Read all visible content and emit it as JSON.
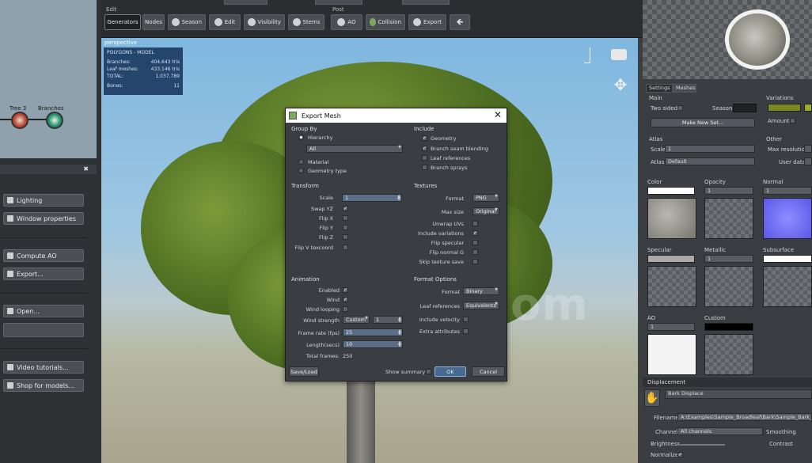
{
  "toolbar": {
    "edit_label": "Edit",
    "post_label": "Post",
    "buttons": [
      {
        "label": "Generators",
        "icon": "generators-icon"
      },
      {
        "label": "Nodes",
        "icon": "nodes-icon"
      },
      {
        "label": "Season",
        "icon": "season-icon"
      },
      {
        "label": "Edit",
        "icon": "edit-icon"
      },
      {
        "label": "Visibility",
        "icon": "visibility-icon"
      },
      {
        "label": "Stems",
        "icon": "stems-icon"
      },
      {
        "label": "AO",
        "icon": "ao-icon"
      },
      {
        "label": "Collision",
        "icon": "collision-icon"
      },
      {
        "label": "Export",
        "icon": "export-icon"
      }
    ]
  },
  "left_panel": {
    "nodes": [
      {
        "label": "Tree 3"
      },
      {
        "label": "Branches"
      }
    ],
    "buttons": {
      "lighting": "Lighting",
      "window_properties": "Window properties",
      "compute_ao": "Compute AO",
      "export": "Export...",
      "open": "Open...",
      "video_tutorials": "Video tutorials...",
      "shop_models": "Shop for models..."
    }
  },
  "viewport": {
    "view_name": "perspective",
    "stats_title": "POLYGONS - MODEL",
    "stats": [
      {
        "label": "Branches:",
        "value": "404,643 tris"
      },
      {
        "label": "Leaf meshes:",
        "value": "433,146 tris"
      },
      {
        "label": "TOTAL:",
        "value": "1,037,789"
      },
      {
        "label": "Bones:",
        "value": "11"
      }
    ],
    "watermark": "iiivfx.com"
  },
  "dialog": {
    "title": "Export Mesh",
    "group_by": {
      "title": "Group By",
      "hierarchy": "Hierarchy",
      "hierarchy_value": "All",
      "material": "Material",
      "geometry_type": "Geometry type"
    },
    "include": {
      "title": "Include",
      "geometry": "Geometry",
      "branch_seam_blending": "Branch seam blending",
      "leaf_references": "Leaf references",
      "branch_sprays": "Branch sprays"
    },
    "transform": {
      "title": "Transform",
      "scale_label": "Scale",
      "scale_value": "1",
      "swap_yz": "Swap YZ",
      "flip_x": "Flip X",
      "flip_y": "Flip Y",
      "flip_z": "Flip Z",
      "flip_v_texcoord": "Flip V texcoord"
    },
    "textures": {
      "title": "Textures",
      "format_label": "Format",
      "format_value": "PNG",
      "max_size_label": "Max size",
      "max_size_value": "Original",
      "unwrap_uvs": "Unwrap UVs",
      "include_variations": "Include variations",
      "flip_specular": "Flip specular",
      "flip_normal_g": "Flip normal G",
      "skip_texture_save": "Skip texture save"
    },
    "animation": {
      "title": "Animation",
      "enabled": "Enabled",
      "wind": "Wind",
      "wind_looping": "Wind looping",
      "wind_strength_label": "Wind strength",
      "wind_strength_mode": "Custom",
      "wind_strength_value": "1",
      "frame_rate_label": "Frame rate (fps)",
      "frame_rate_value": "25",
      "length_label": "Length(secs)",
      "length_value": "10",
      "total_frames_label": "Total frames:",
      "total_frames_value": "250"
    },
    "format_options": {
      "title": "Format Options",
      "format_label": "Format",
      "format_value": "Binary",
      "leaf_references_label": "Leaf references",
      "leaf_references_value": "Equivalents",
      "include_velocity": "Include velocity",
      "extra_attributes": "Extra attributes"
    },
    "footer": {
      "save_load": "Save/Load",
      "show_summary": "Show summary",
      "ok": "OK",
      "cancel": "Cancel"
    }
  },
  "right_panel": {
    "tabs": {
      "settings": "Settings",
      "meshes": "Meshes"
    },
    "main_title": "Main",
    "two_sided": "Two sided",
    "season_label": "Season",
    "make_new_set": "Make New Set...",
    "variations": "Variations",
    "amount": "Amount",
    "atlas_title": "Atlas",
    "scale_label": "Scale",
    "scale_value": "1",
    "atlas_label": "Atlas",
    "atlas_value": "Default",
    "other_title": "Other",
    "max_resolution": "Max resolution",
    "user_data": "User data",
    "maps": [
      "Color",
      "Opacity",
      "Normal",
      "Specular",
      "Metallic",
      "Subsurface",
      "AO",
      "Custom"
    ],
    "map_value": "1",
    "displacement_title": "Displacement",
    "displacement_name": "Bark Displace",
    "filename_label": "Filename",
    "filename_value": "A:\\Examples\\Sample_Broadleaf\\Bark\\Sample_Bark_2_D",
    "channel_label": "Channel",
    "channel_value": "All channels",
    "smoothing_label": "Smoothing",
    "brightness_label": "Brightness",
    "contrast_label": "Contrast",
    "normalize_label": "Normalize",
    "colors": {
      "variation_swatch": "#7a8a22",
      "specular_swatch": "#aaaaaa",
      "custom_swatch": "#000000"
    }
  }
}
